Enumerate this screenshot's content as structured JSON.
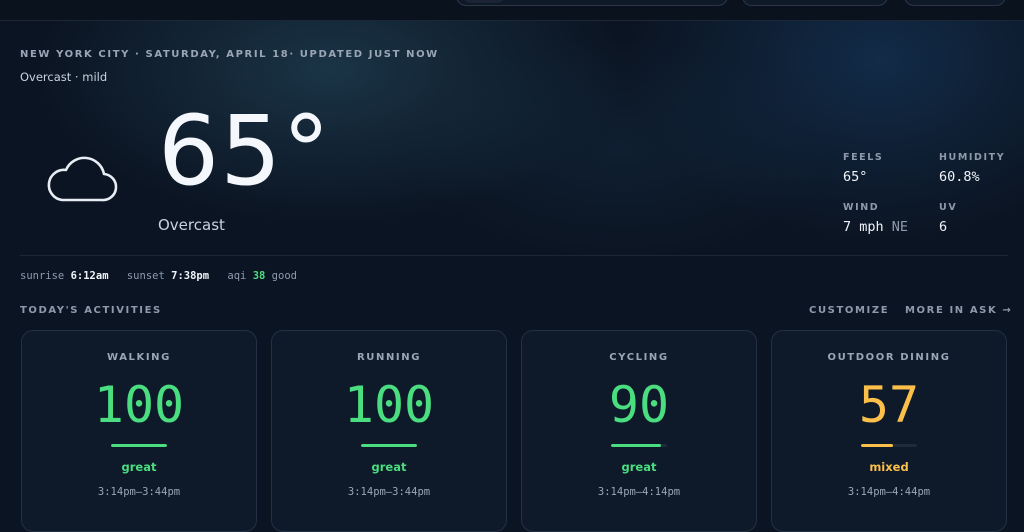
{
  "header": {
    "location_line": "NEW YORK CITY · SATURDAY, APRIL 18· UPDATED JUST NOW",
    "condition_line": "Overcast · mild"
  },
  "current": {
    "icon": "cloud-icon",
    "temperature": "65°",
    "condition": "Overcast"
  },
  "stats": {
    "feels": {
      "label": "FEELS",
      "value": "65°"
    },
    "humidity": {
      "label": "HUMIDITY",
      "value": "60.8%"
    },
    "wind": {
      "label": "WIND",
      "value": "7 mph",
      "direction": "NE"
    },
    "uv": {
      "label": "UV",
      "value": "6"
    }
  },
  "sun": {
    "sunrise_label": "sunrise",
    "sunrise": "6:12am",
    "sunset_label": "sunset",
    "sunset": "7:38pm",
    "aqi_label": "aqi",
    "aqi_value": "38",
    "aqi_rating": "good"
  },
  "activities": {
    "title": "TODAY'S ACTIVITIES",
    "customize_label": "CUSTOMIZE",
    "more_label": "MORE IN ASK →",
    "colors": {
      "great": "#4ade80",
      "mixed": "#fbbf4a"
    },
    "items": [
      {
        "name": "WALKING",
        "score": "100",
        "rating": "great",
        "window": "3:14pm–3:44pm",
        "level": 1.0
      },
      {
        "name": "RUNNING",
        "score": "100",
        "rating": "great",
        "window": "3:14pm–3:44pm",
        "level": 1.0
      },
      {
        "name": "CYCLING",
        "score": "90",
        "rating": "great",
        "window": "3:14pm–4:14pm",
        "level": 0.9
      },
      {
        "name": "OUTDOOR DINING",
        "score": "57",
        "rating": "mixed",
        "window": "3:14pm–4:44pm",
        "level": 0.57
      }
    ]
  }
}
